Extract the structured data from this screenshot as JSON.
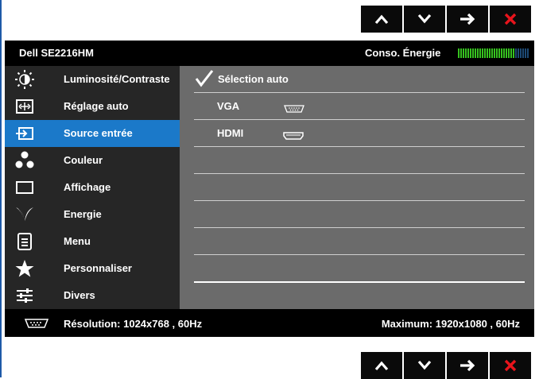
{
  "nav_buttons": [
    {
      "name": "up-button",
      "icon": "caret-up-icon"
    },
    {
      "name": "down-button",
      "icon": "caret-down-icon"
    },
    {
      "name": "enter-button",
      "icon": "arrow-right-icon"
    },
    {
      "name": "exit-button",
      "icon": "close-icon"
    }
  ],
  "header": {
    "model": "Dell  SE2216HM",
    "energy_label": "Conso. Énergie",
    "energy_level_fraction": 0.8
  },
  "sidebar": {
    "items": [
      {
        "label": "Luminosité/Contraste",
        "icon": "brightness-icon",
        "active": false
      },
      {
        "label": "Réglage auto",
        "icon": "auto-adjust-icon",
        "active": false
      },
      {
        "label": "Source entrée",
        "icon": "input-source-icon",
        "active": true
      },
      {
        "label": "Couleur",
        "icon": "color-dots-icon",
        "active": false
      },
      {
        "label": "Affichage",
        "icon": "display-rect-icon",
        "active": false
      },
      {
        "label": "Energie",
        "icon": "energy-leaf-icon",
        "active": false
      },
      {
        "label": "Menu",
        "icon": "menu-doc-icon",
        "active": false
      },
      {
        "label": "Personnaliser",
        "icon": "star-icon",
        "active": false
      },
      {
        "label": "Divers",
        "icon": "sliders-icon",
        "active": false
      }
    ]
  },
  "content": {
    "rows": [
      {
        "label": "Sélection auto",
        "checked": true,
        "icon": "checkmark-icon"
      },
      {
        "label": "VGA",
        "icon": "vga-port-icon"
      },
      {
        "label": "HDMI",
        "icon": "hdmi-port-icon"
      },
      {
        "label": ""
      },
      {
        "label": ""
      },
      {
        "label": ""
      },
      {
        "label": ""
      },
      {
        "label": ""
      }
    ]
  },
  "status": {
    "resolution": "Résolution: 1024x768 , 60Hz",
    "maximum": "Maximum: 1920x1080 , 60Hz",
    "icon": "vga-port-icon"
  },
  "colors": {
    "accent": "#1b79c9",
    "sidebar_bg": "#262626",
    "content_bg": "#6b6b6b",
    "meter_on": "#36c21f",
    "meter_off": "#1d4a75",
    "close_red": "#e8141c"
  }
}
